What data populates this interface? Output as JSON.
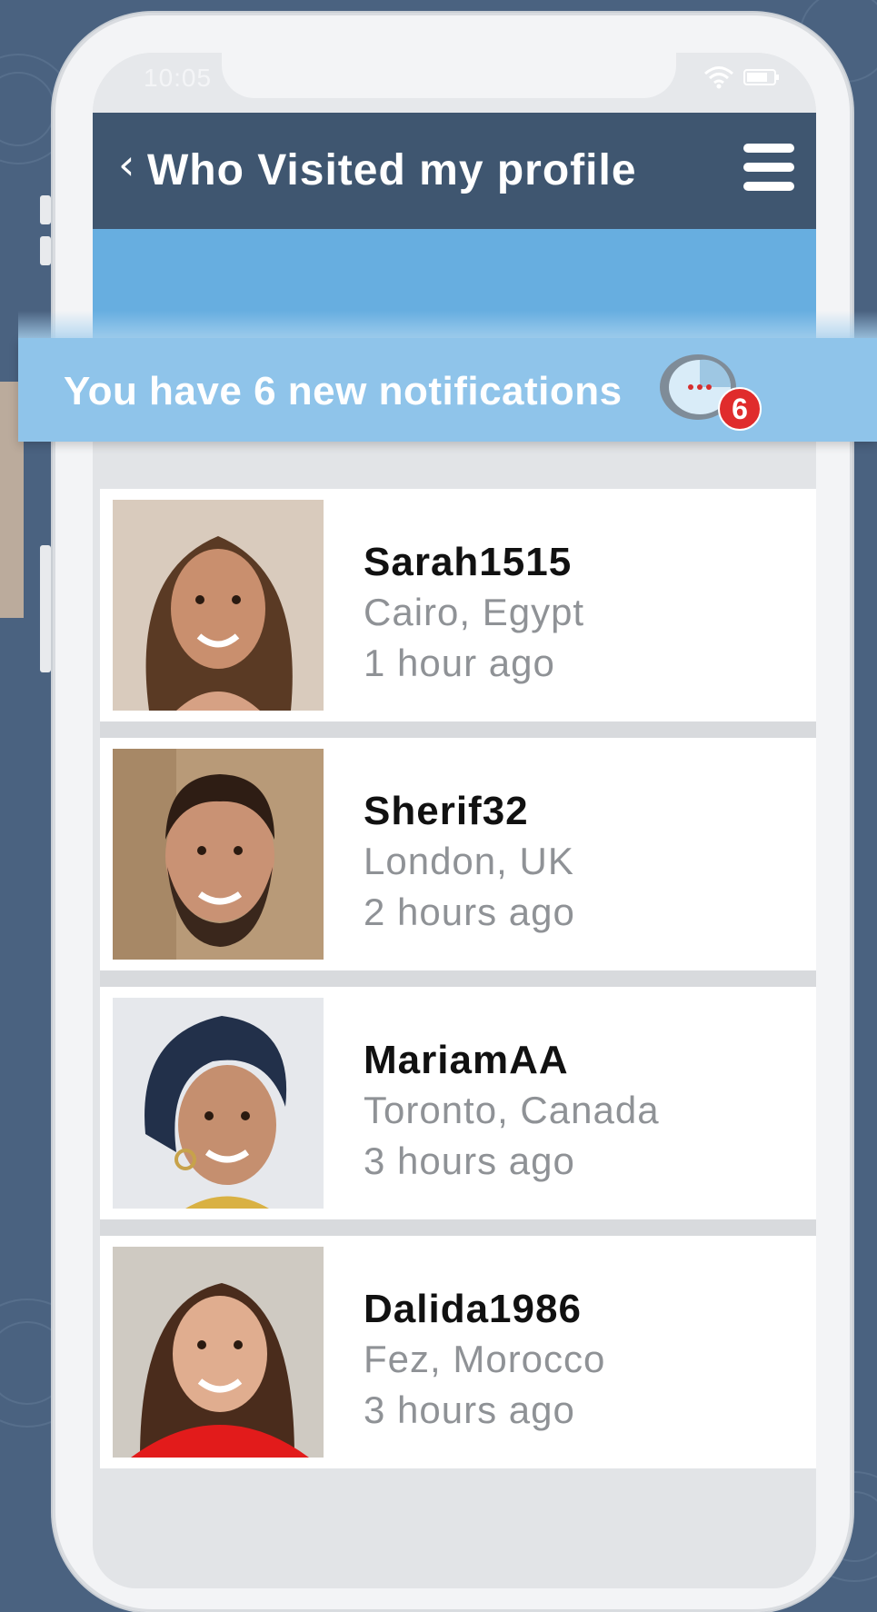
{
  "status_bar": {
    "time": "10:05"
  },
  "header": {
    "back_icon": "chevron-left-icon",
    "title": "Who Visited my profile",
    "menu_icon": "hamburger-menu-icon"
  },
  "notification_banner": {
    "text": "You have 6 new notifications",
    "badge_count": "6",
    "icon": "notification-chat-icon"
  },
  "visitors": [
    {
      "username": "Sarah1515",
      "location": "Cairo, Egypt",
      "time_ago": "1 hour ago"
    },
    {
      "username": "Sherif32",
      "location": "London, UK",
      "time_ago": "2 hours ago"
    },
    {
      "username": "MariamAA",
      "location": "Toronto, Canada",
      "time_ago": "3 hours ago"
    },
    {
      "username": "Dalida1986",
      "location": "Fez, Morocco",
      "time_ago": "3 hours ago"
    }
  ],
  "colors": {
    "header": "#3f5670",
    "band": "#67aee0",
    "banner": "#8fc4ea",
    "badge": "#e02c2c",
    "background": "#4a6280"
  }
}
